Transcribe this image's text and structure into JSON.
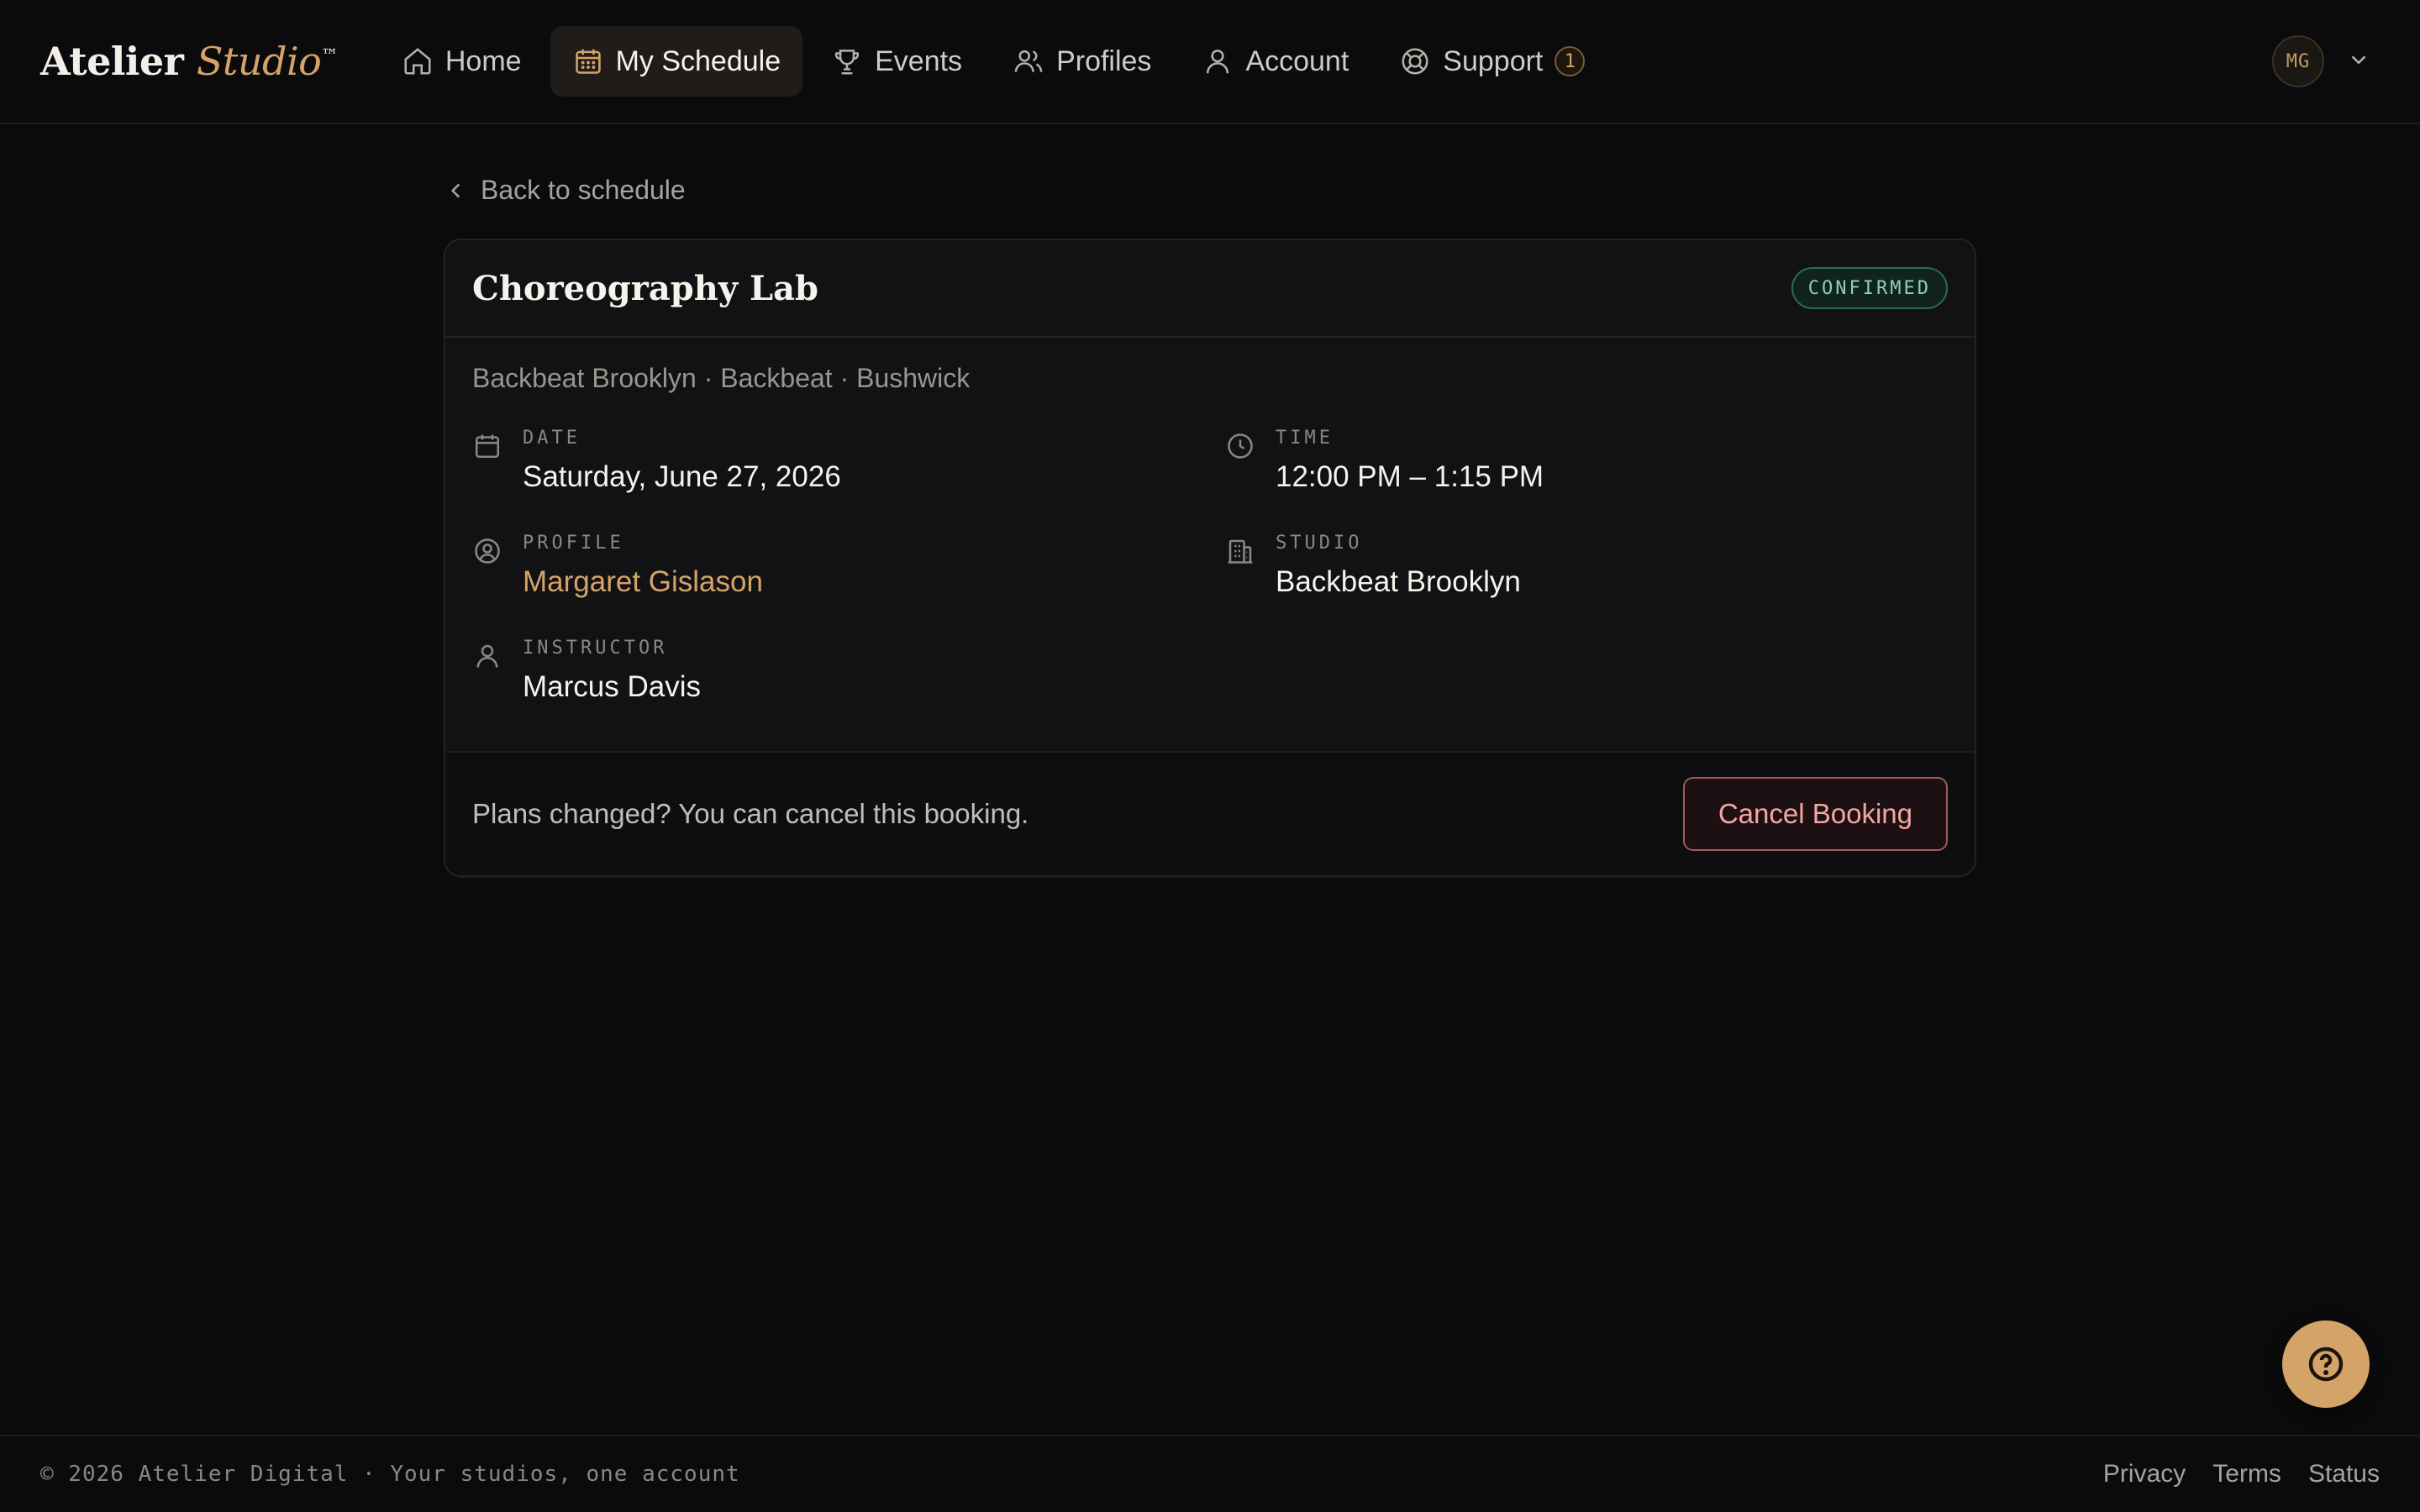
{
  "brand": {
    "name": "Atelier",
    "accent": "Studio",
    "tm": "™"
  },
  "nav": {
    "items": [
      {
        "label": "Home",
        "icon": "home-icon"
      },
      {
        "label": "My Schedule",
        "icon": "calendar-icon",
        "active": true
      },
      {
        "label": "Events",
        "icon": "trophy-icon"
      },
      {
        "label": "Profiles",
        "icon": "users-icon"
      },
      {
        "label": "Account",
        "icon": "user-icon"
      },
      {
        "label": "Support",
        "icon": "lifebuoy-icon",
        "badge": "1"
      }
    ]
  },
  "user": {
    "initials": "MG"
  },
  "back": {
    "label": "Back to schedule"
  },
  "booking": {
    "title": "Choreography Lab",
    "status": "CONFIRMED",
    "location": "Backbeat Brooklyn · Backbeat · Bushwick",
    "fields": {
      "date": {
        "label": "DATE",
        "value": "Saturday, June 27, 2026"
      },
      "time": {
        "label": "TIME",
        "value": "12:00 PM – 1:15 PM"
      },
      "profile": {
        "label": "PROFILE",
        "value": "Margaret Gislason"
      },
      "studio": {
        "label": "STUDIO",
        "value": "Backbeat Brooklyn"
      },
      "instructor": {
        "label": "INSTRUCTOR",
        "value": "Marcus Davis"
      }
    },
    "footer_text": "Plans changed? You can cancel this booking.",
    "cancel_label": "Cancel Booking"
  },
  "footer": {
    "copyright": "© 2026 Atelier Digital · Your studios, one account",
    "links": [
      "Privacy",
      "Terms",
      "Status"
    ]
  },
  "colors": {
    "background": "#0b0b0d",
    "accent": "#d4a367",
    "confirmed": "#8fd0b0",
    "danger": "#f3a7a2"
  }
}
